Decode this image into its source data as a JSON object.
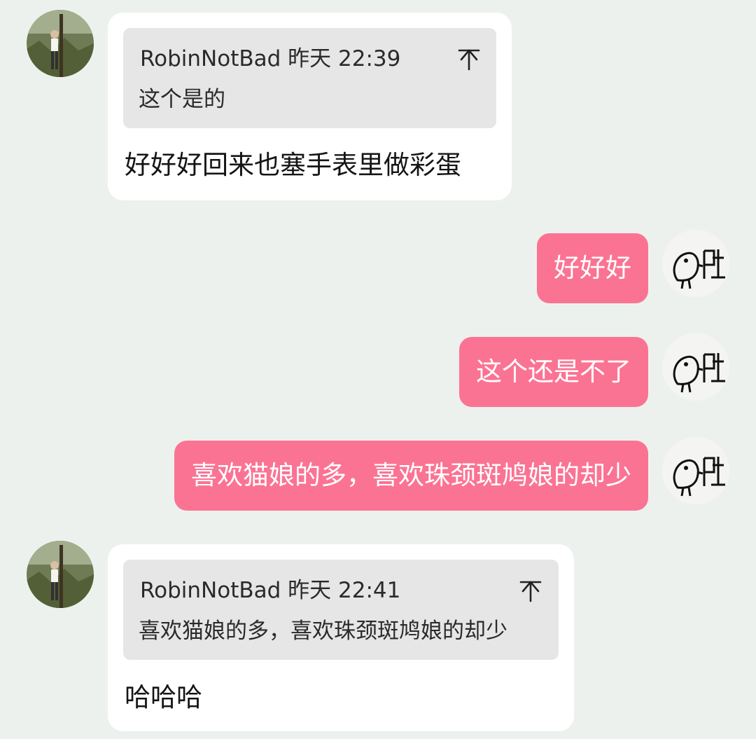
{
  "messages": [
    {
      "side": "incoming",
      "quote": {
        "author": "RobinNotBad",
        "date": "昨天",
        "time": "22:39",
        "text": "这个是的"
      },
      "text": "好好好回来也塞手表里做彩蛋"
    },
    {
      "side": "outgoing",
      "text": "好好好"
    },
    {
      "side": "outgoing",
      "text": "这个还是不了"
    },
    {
      "side": "outgoing",
      "text": "喜欢猫娘的多，喜欢珠颈斑鸠娘的却少"
    },
    {
      "side": "incoming",
      "quote": {
        "author": "RobinNotBad",
        "date": "昨天",
        "time": "22:41",
        "text": "喜欢猫娘的多，喜欢珠颈斑鸠娘的却少"
      },
      "text": "哈哈哈"
    }
  ],
  "colors": {
    "background": "#edf1ee",
    "incoming_bubble": "#ffffff",
    "quote_box": "#e6e6e6",
    "outgoing_bubble": "#fb7393",
    "outgoing_text": "#ffffff"
  },
  "icons": {
    "incoming_avatar": "forest-photo-avatar",
    "outgoing_avatar": "dove-doodle-avatar",
    "quote_action": "fold-arrow-icon"
  }
}
